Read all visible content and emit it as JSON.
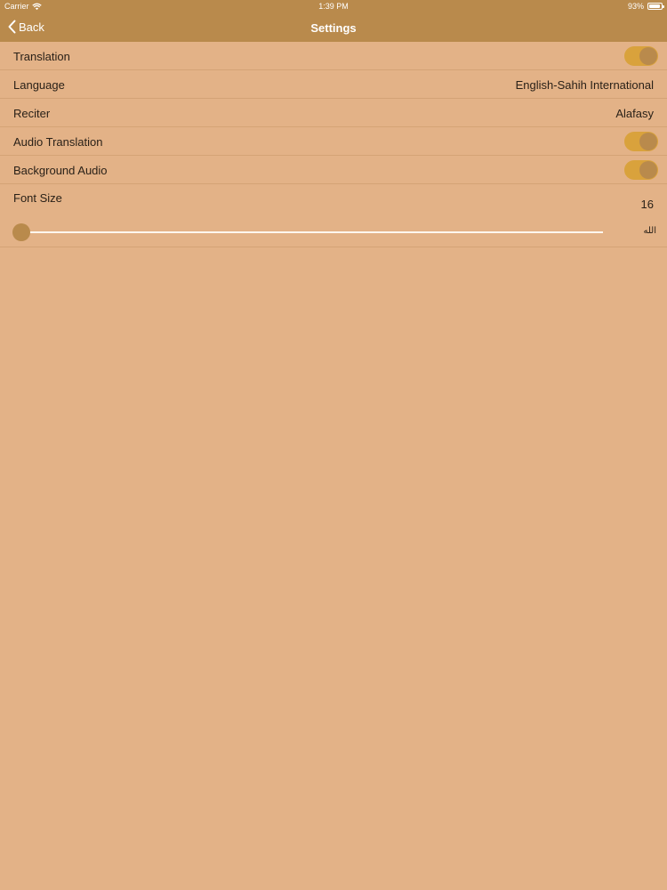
{
  "status_bar": {
    "carrier": "Carrier",
    "time": "1:39 PM",
    "battery": "93%",
    "battery_level": 0.93
  },
  "nav": {
    "back_label": "Back",
    "title": "Settings"
  },
  "settings": {
    "translation": {
      "label": "Translation",
      "on": true
    },
    "language": {
      "label": "Language",
      "value": "English-Sahih International"
    },
    "reciter": {
      "label": "Reciter",
      "value": "Alafasy"
    },
    "audio_translation": {
      "label": "Audio Translation",
      "on": true
    },
    "background_audio": {
      "label": "Background Audio",
      "on": true
    },
    "font_size": {
      "label": "Font Size",
      "value": "16",
      "preview": "الله",
      "slider_fraction": 0.0
    }
  },
  "colors": {
    "background": "#e3b287",
    "bar": "#b98a4c",
    "toggle_on": "#d9a23c"
  },
  "icons": [
    "wifi-icon",
    "battery-icon",
    "chevron-left-icon"
  ]
}
